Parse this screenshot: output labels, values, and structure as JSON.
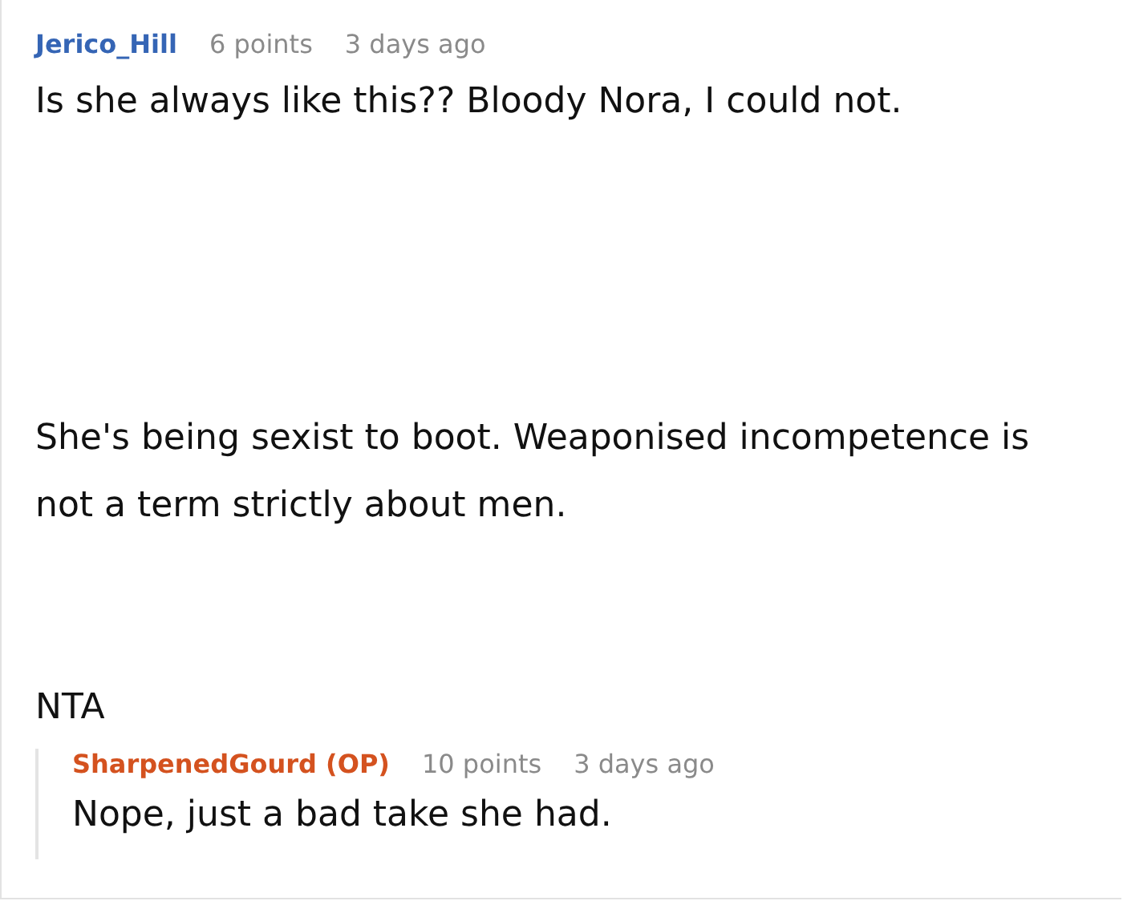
{
  "comment": {
    "author": "Jerico_Hill",
    "op": false,
    "points": "6 points",
    "time": "3 days ago",
    "paragraphs": [
      "Is she always like this?? Bloody Nora, I could not.",
      "She's being sexist to boot. Weaponised incompetence is not a term strictly about men.",
      "NTA"
    ],
    "replies": [
      {
        "author": "SharpenedGourd (OP)",
        "op": true,
        "points": "10 points",
        "time": "3 days ago",
        "paragraphs": [
          "Nope, just a bad take she had."
        ]
      }
    ]
  }
}
